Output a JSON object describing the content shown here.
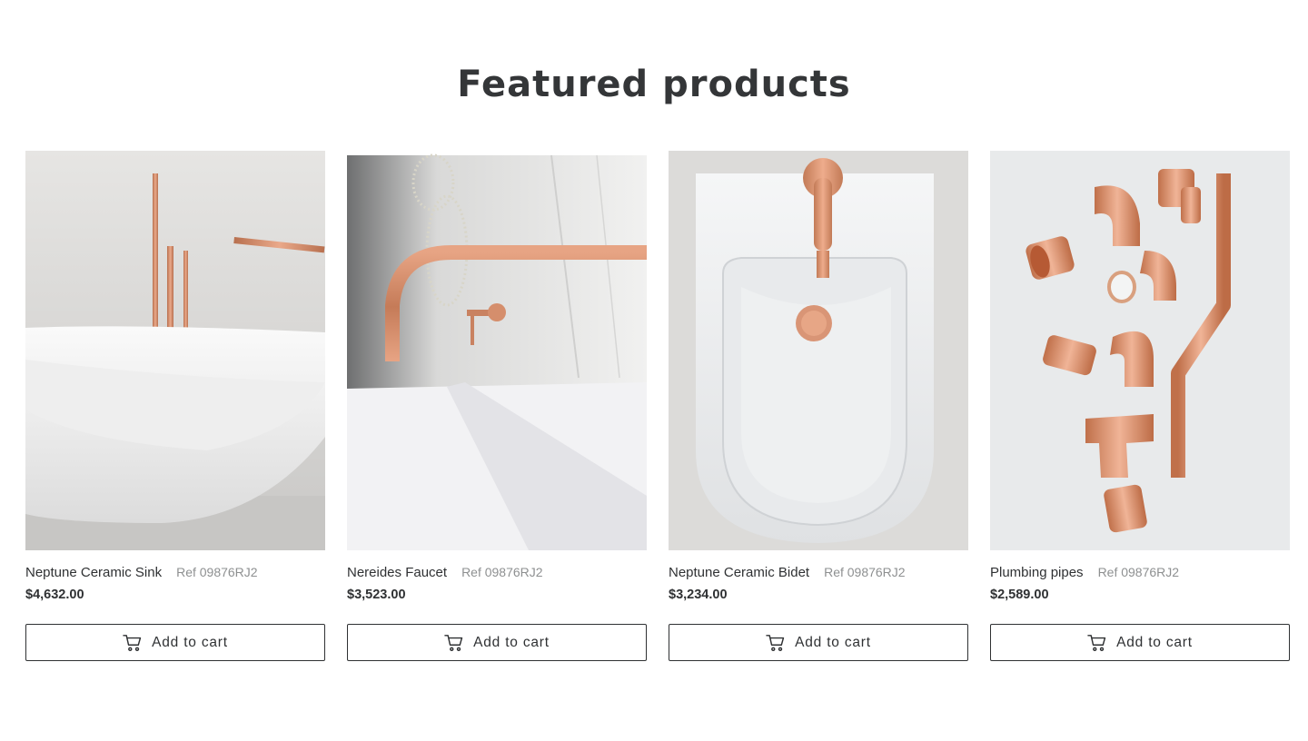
{
  "section": {
    "title": "Featured products"
  },
  "products": [
    {
      "name": "Neptune Ceramic Sink",
      "ref": "Ref 09876RJ2",
      "price": "$4,632.00",
      "cta": "Add to cart",
      "image": "copper faucet with white ceramic bathtub"
    },
    {
      "name": "Nereides Faucet",
      "ref": "Ref 09876RJ2",
      "price": "$3,523.00",
      "cta": "Add to cart",
      "image": "copper wall-mounted faucet over white basin"
    },
    {
      "name": "Neptune Ceramic Bidet",
      "ref": "Ref 09876RJ2",
      "price": "$3,234.00",
      "cta": "Add to cart",
      "image": "top view of white bidet with copper tap"
    },
    {
      "name": "Plumbing pipes",
      "ref": "Ref 09876RJ2",
      "price": "$2,589.00",
      "cta": "Add to cart",
      "image": "assorted copper pipe fittings on light background"
    }
  ],
  "icons": {
    "cart": "cart-icon"
  },
  "colors": {
    "text": "#2f3133",
    "muted": "#8e9091",
    "copper": "#d99474",
    "border": "#2f3133"
  }
}
